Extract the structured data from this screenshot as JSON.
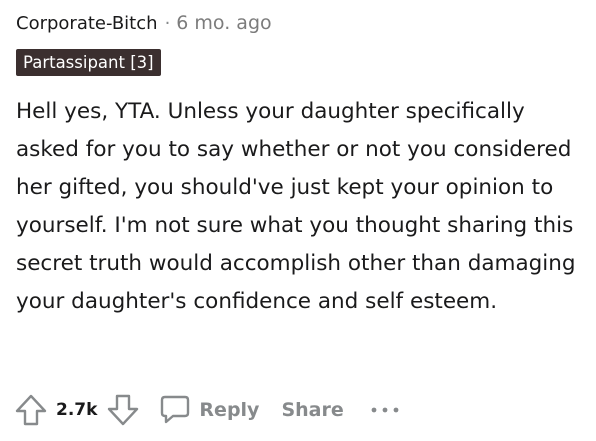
{
  "comment": {
    "author": "Corporate-Bitch",
    "separator": "·",
    "timestamp": "6 mo. ago",
    "flair": "Partassipant [3]",
    "body": "Hell yes, YTA. Unless your daughter specifically asked for you to say whether or not you considered her gifted, you should've just kept your opinion to yourself. I'm not sure what you thought sharing this secret truth would accomplish other than damaging your daughter's confidence and self esteem."
  },
  "actions": {
    "upvote_icon": "upvote-arrow-icon",
    "vote_count": "2.7k",
    "downvote_icon": "downvote-arrow-icon",
    "reply_icon": "speech-bubble-icon",
    "reply_label": "Reply",
    "share_label": "Share",
    "more_icon": "ellipsis-icon"
  },
  "colors": {
    "text": "#1a1a1b",
    "muted": "#878a8c",
    "flair_bg": "#3b2f2f",
    "flair_text": "#ffffff"
  }
}
